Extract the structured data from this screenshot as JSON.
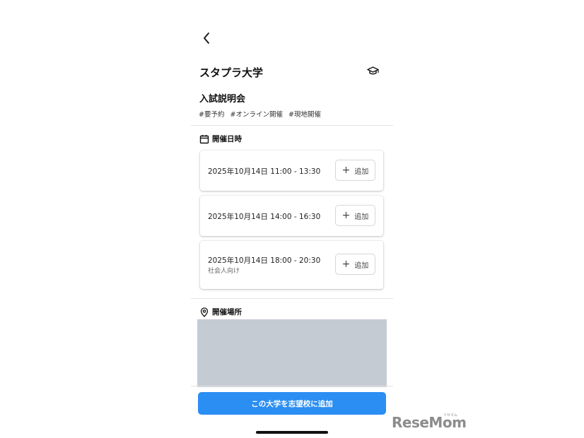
{
  "header": {
    "back_icon": "chevron-left-icon",
    "university_name": "スタプラ大学",
    "graduation_icon": "graduation-cap-icon"
  },
  "event": {
    "title": "入試説明会",
    "tags": [
      "#要予約",
      "#オンライン開催",
      "#現地開催"
    ]
  },
  "schedule": {
    "heading": "開催日時",
    "icon": "calendar-icon",
    "add_label": "追加",
    "items": [
      {
        "datetime": "2025年10月14日 11:00 - 13:30",
        "note": ""
      },
      {
        "datetime": "2025年10月14日 14:00 - 16:30",
        "note": ""
      },
      {
        "datetime": "2025年10月14日 18:00 - 20:30",
        "note": "社会人向け"
      }
    ]
  },
  "location": {
    "heading": "開催場所",
    "icon": "map-pin-icon"
  },
  "cta": {
    "label": "この大学を志望校に追加",
    "color": "#2b8ef3"
  },
  "watermark": {
    "text": "ReseMom",
    "sub": "リセマム"
  }
}
